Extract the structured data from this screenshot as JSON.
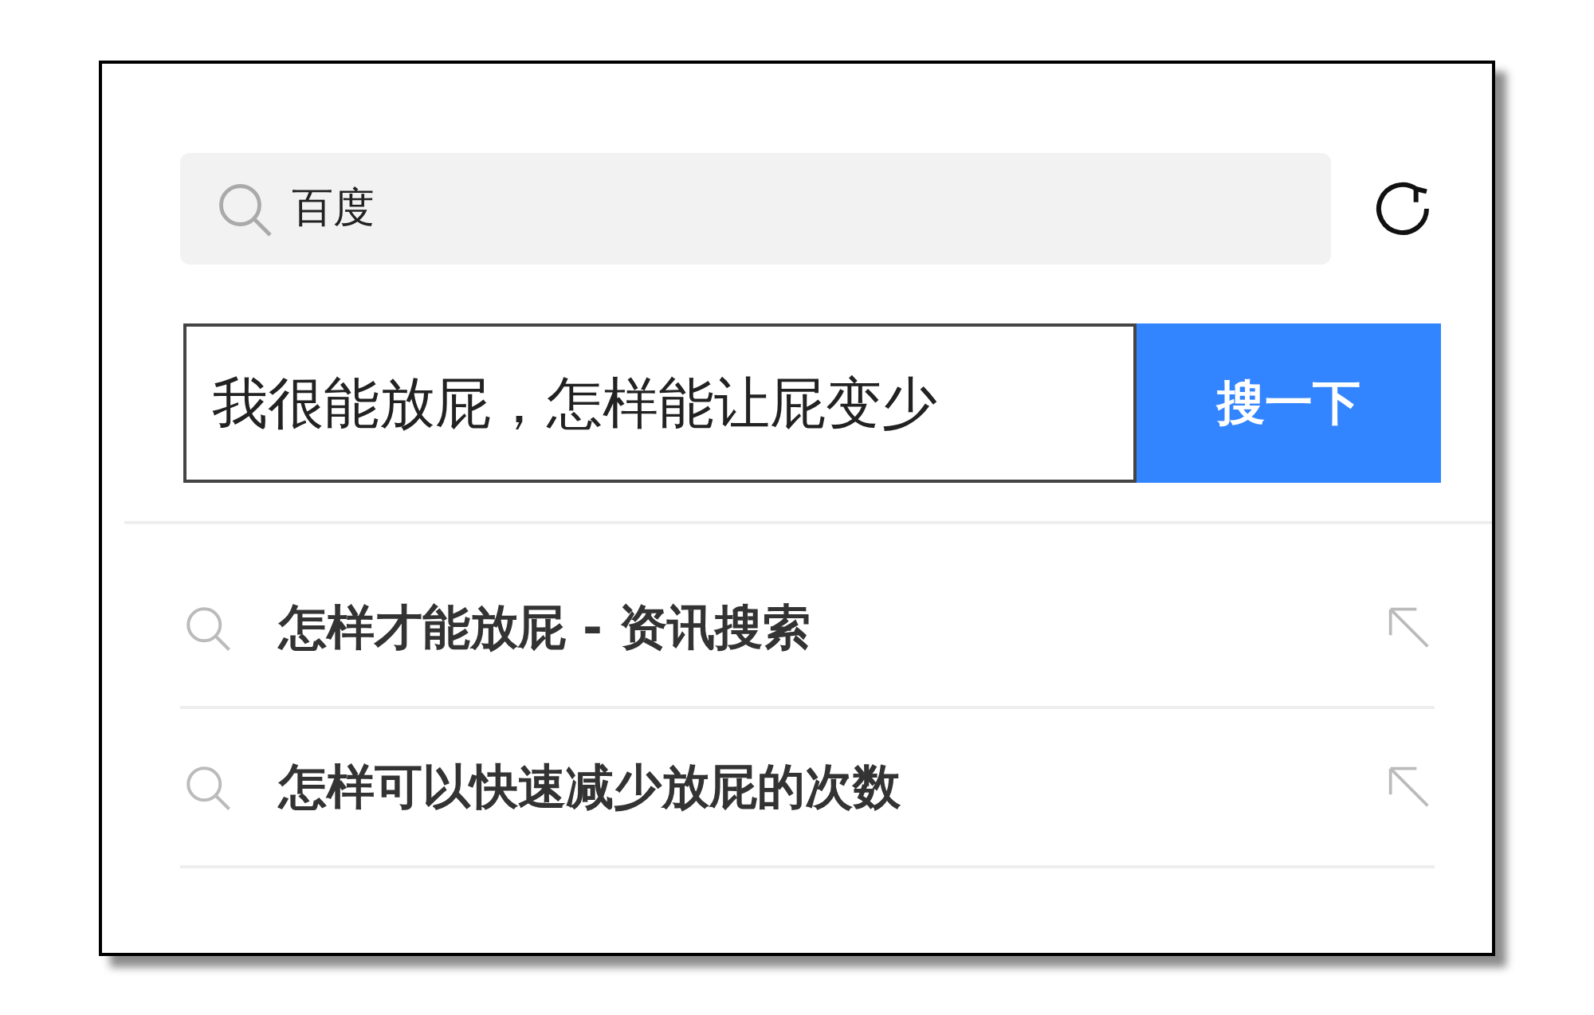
{
  "top_bar": {
    "search_chip": "百度"
  },
  "search": {
    "value": "我很能放屁，怎样能让屁变少",
    "button": "搜一下"
  },
  "suggestions": [
    {
      "text": "怎样才能放屁 - 资讯搜索"
    },
    {
      "text": "怎样可以快速减少放屁的次数"
    }
  ]
}
